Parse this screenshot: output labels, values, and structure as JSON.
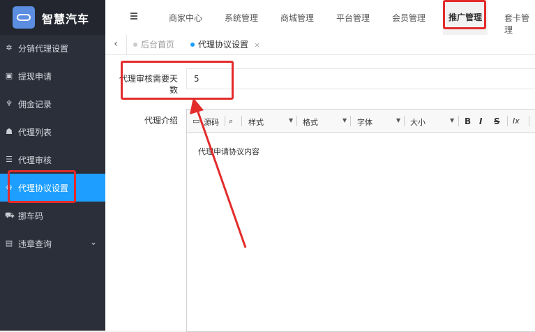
{
  "app": {
    "title": "智慧汽车"
  },
  "sidebar": {
    "items": [
      {
        "label": "分销代理设置",
        "icon": "gear-icon"
      },
      {
        "label": "提现申请",
        "icon": "wallet-icon"
      },
      {
        "label": "佣金记录",
        "icon": "trophy-icon"
      },
      {
        "label": "代理列表",
        "icon": "users-icon"
      },
      {
        "label": "代理审核",
        "icon": "list-icon"
      },
      {
        "label": "代理协议设置",
        "icon": "circle-icon",
        "active": true
      },
      {
        "label": "挪车码",
        "icon": "car-icon"
      },
      {
        "label": "违章查询",
        "icon": "card-icon",
        "expand": true
      }
    ]
  },
  "topnav": {
    "items": [
      "商家中心",
      "系统管理",
      "商城管理",
      "平台管理",
      "会员管理",
      "推广管理",
      "套卡管理"
    ]
  },
  "tabs": [
    {
      "label": "后台首页"
    },
    {
      "label": "代理协议设置",
      "close": "×"
    }
  ],
  "form": {
    "days_label": "代理审核需要天数",
    "days_value": "5",
    "intro_label": "代理介绍"
  },
  "editor": {
    "source_label": "源码",
    "style_label": "样式",
    "format_label": "格式",
    "font_label": "字体",
    "size_label": "大小",
    "bold": "B",
    "italic": "I",
    "strike": "S",
    "clear": "Ix",
    "content": "代理申请协议内容"
  },
  "colors": {
    "accent": "#1e9fff",
    "sidebar": "#2b2f3a",
    "annotation": "#e32b2b"
  }
}
